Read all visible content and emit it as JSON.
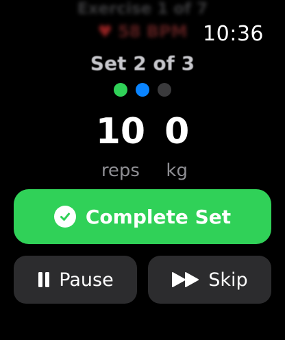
{
  "status": {
    "time": "10:36"
  },
  "header": {
    "exercise": "Exercise 1 of 7",
    "heart_rate": "58 BPM",
    "set_label": "Set 2 of 3"
  },
  "progress": {
    "sets_total": 3,
    "current_set": 2,
    "dot_colors": [
      "#30d158",
      "#0a84ff",
      "#3a3a3c"
    ]
  },
  "metrics": {
    "reps": {
      "value": "10",
      "unit": "reps"
    },
    "weight": {
      "value": "0",
      "unit": "kg"
    }
  },
  "actions": {
    "complete_label": "Complete Set",
    "pause_label": "Pause",
    "skip_label": "Skip"
  },
  "colors": {
    "accent_green": "#30d158",
    "accent_blue": "#0a84ff",
    "button_dark": "#2c2c2e",
    "muted_text": "#8e8e93"
  },
  "icons": {
    "heart": "heart-icon",
    "check": "checkmark-circle-icon",
    "pause": "pause-icon",
    "skip": "forward-icon"
  }
}
